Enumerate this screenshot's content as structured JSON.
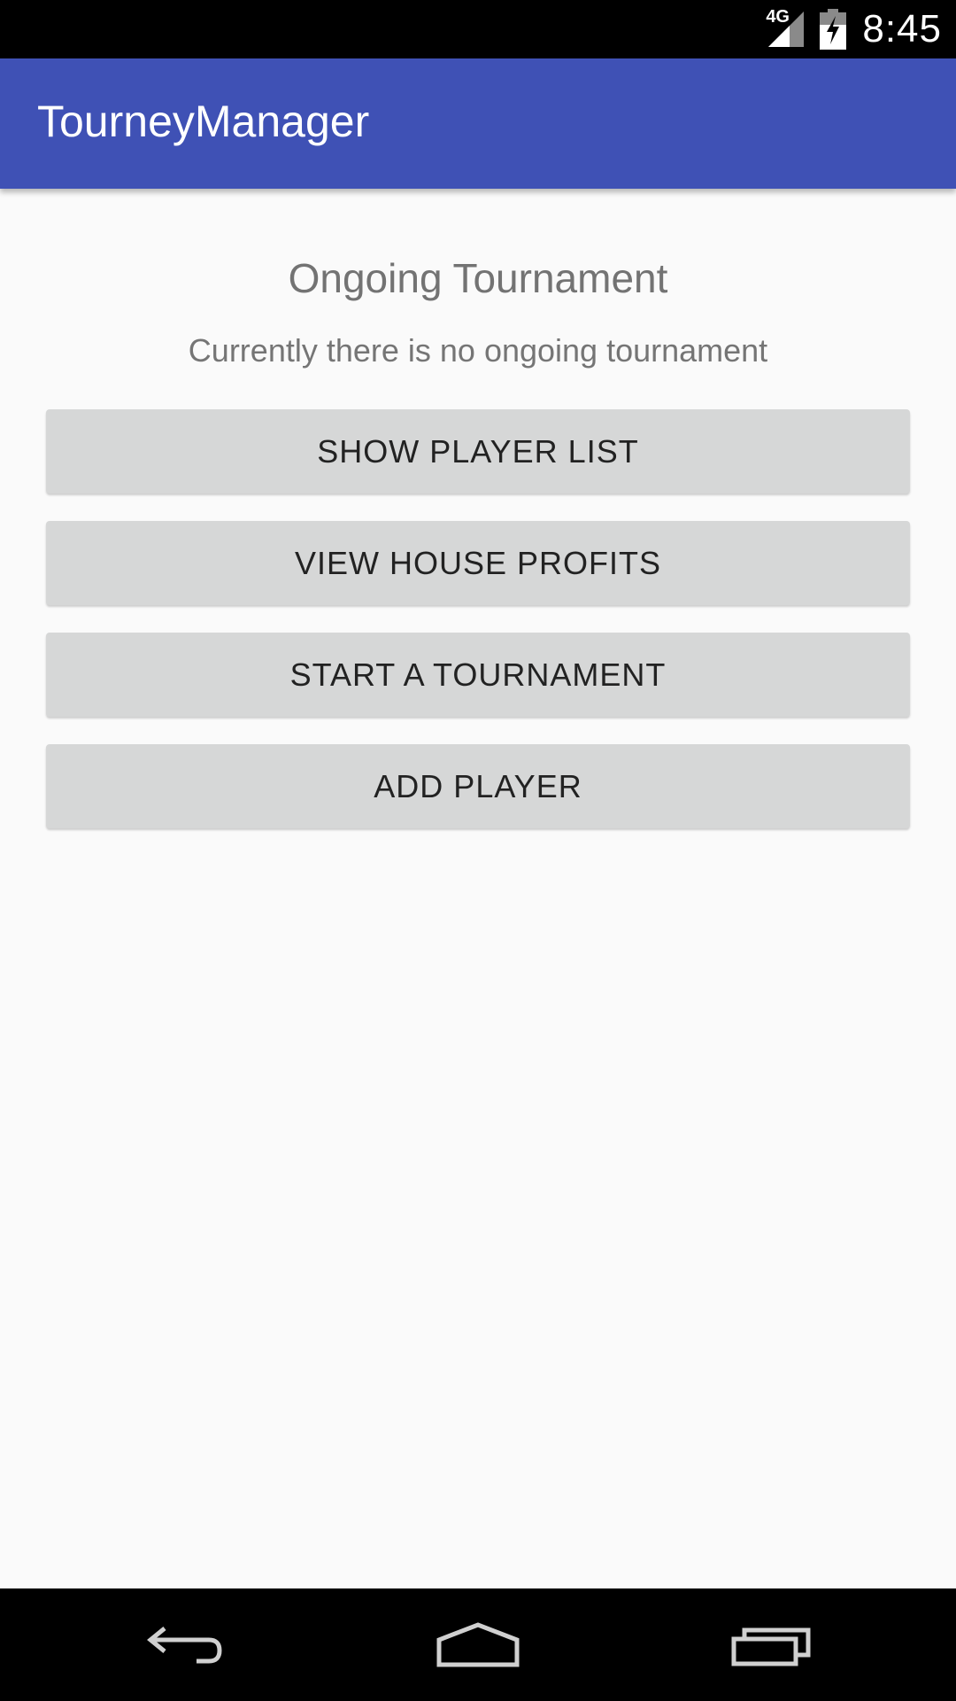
{
  "status_bar": {
    "network": "4G",
    "time": "8:45",
    "icons": [
      "signal-icon",
      "battery-charging-icon"
    ]
  },
  "app_bar": {
    "title": "TourneyManager"
  },
  "main": {
    "section_title": "Ongoing Tournament",
    "section_status": "Currently there is no ongoing tournament",
    "buttons": [
      {
        "label": "SHOW PLAYER LIST"
      },
      {
        "label": "VIEW HOUSE PROFITS"
      },
      {
        "label": "START A TOURNAMENT"
      },
      {
        "label": "ADD PLAYER"
      }
    ]
  },
  "nav_bar": {
    "icons": [
      "back-icon",
      "home-icon",
      "recents-icon"
    ]
  },
  "colors": {
    "app_bar": "#3f51b5",
    "button_bg": "#d6d7d7",
    "background": "#fafafa"
  }
}
